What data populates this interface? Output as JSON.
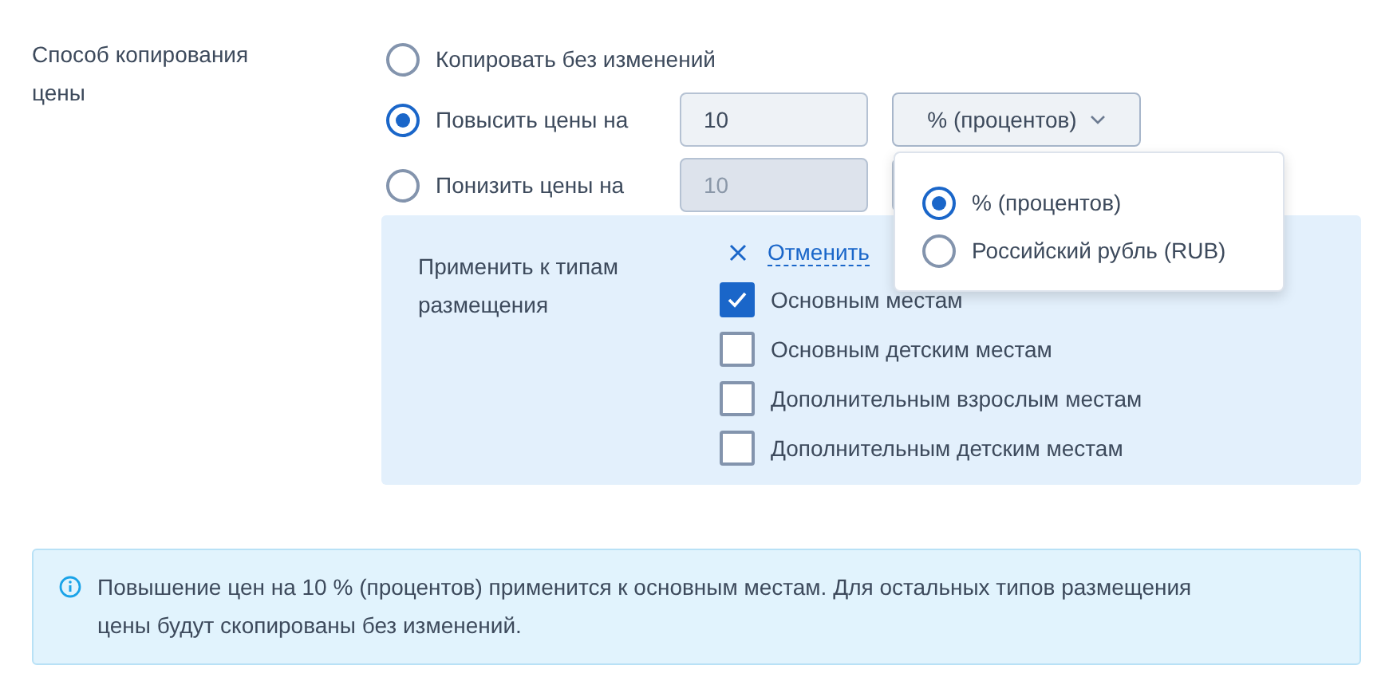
{
  "copy_method": {
    "label": "Способ копирования цены",
    "options": [
      {
        "kind": "plain",
        "label": "Копировать без изменений",
        "selected": false
      },
      {
        "kind": "amount",
        "label": "Повысить цены на",
        "selected": true,
        "value": "10",
        "disabled": false,
        "unit": "% (процентов)",
        "expanded": true
      },
      {
        "kind": "amount",
        "label": "Понизить цены на",
        "selected": false,
        "value": "10",
        "disabled": true
      }
    ],
    "unit_menu": [
      {
        "label": "% (процентов)",
        "selected": true
      },
      {
        "label": "Российский рубль (RUB)",
        "selected": false
      }
    ]
  },
  "apply": {
    "label": "Применить к типам размещения",
    "cancel": "Отменить",
    "types": [
      {
        "label": "Основным местам",
        "checked": true
      },
      {
        "label": "Основным детским местам",
        "checked": false
      },
      {
        "label": "Дополнительным взрослым местам",
        "checked": false
      },
      {
        "label": "Дополнительным детским местам",
        "checked": false
      }
    ]
  },
  "info": "Повышение цен на 10 % (процентов) применится к основным местам. Для остальных типов размещения цены будут скопированы без изменений."
}
